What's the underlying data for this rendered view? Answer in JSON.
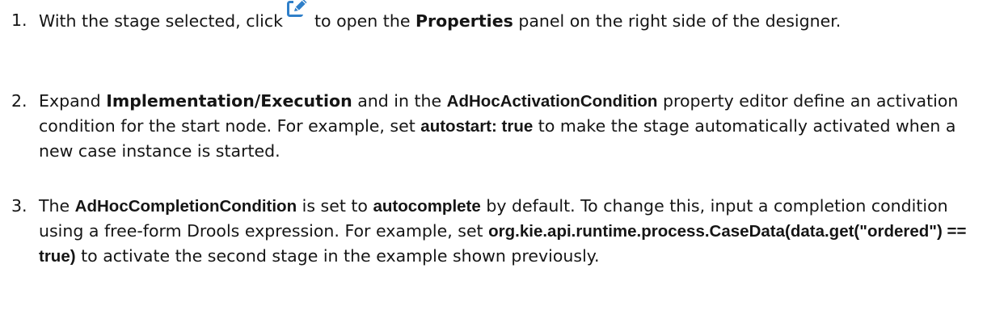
{
  "steps": [
    {
      "number": "1.",
      "text_before_icon": "With the stage selected, click",
      "icon": "edit-icon",
      "text_after_icon": "to open the",
      "properties_label": "Properties",
      "text_end": "panel on the right side of the designer."
    },
    {
      "number": "2.",
      "expand_word": "Expand",
      "implementation_label": "Implementation/Execution",
      "text_mid": "and in the",
      "activation_condition_label": "AdHocActivationCondition",
      "text_after_label": "property editor define an activation condition for the start node. For example, set",
      "autostart_value": "autostart: true",
      "text_end": "to make the stage automatically activated when a new case instance is started."
    },
    {
      "number": "3.",
      "the_word": "The",
      "completion_condition_label": "AdHocCompletionCondition",
      "text_mid": "is set to",
      "autocomplete_value": "autocomplete",
      "text_after_value": "by default. To change this, input a completion condition using a free-form Drools expression. For example, set",
      "expression_value": "org.kie.api.runtime.process.CaseData(data.get(\"ordered\") == true)",
      "text_end": "to activate the second stage in the example shown previously."
    }
  ],
  "colors": {
    "text": "#151515",
    "icon": "#2f7fc9"
  }
}
